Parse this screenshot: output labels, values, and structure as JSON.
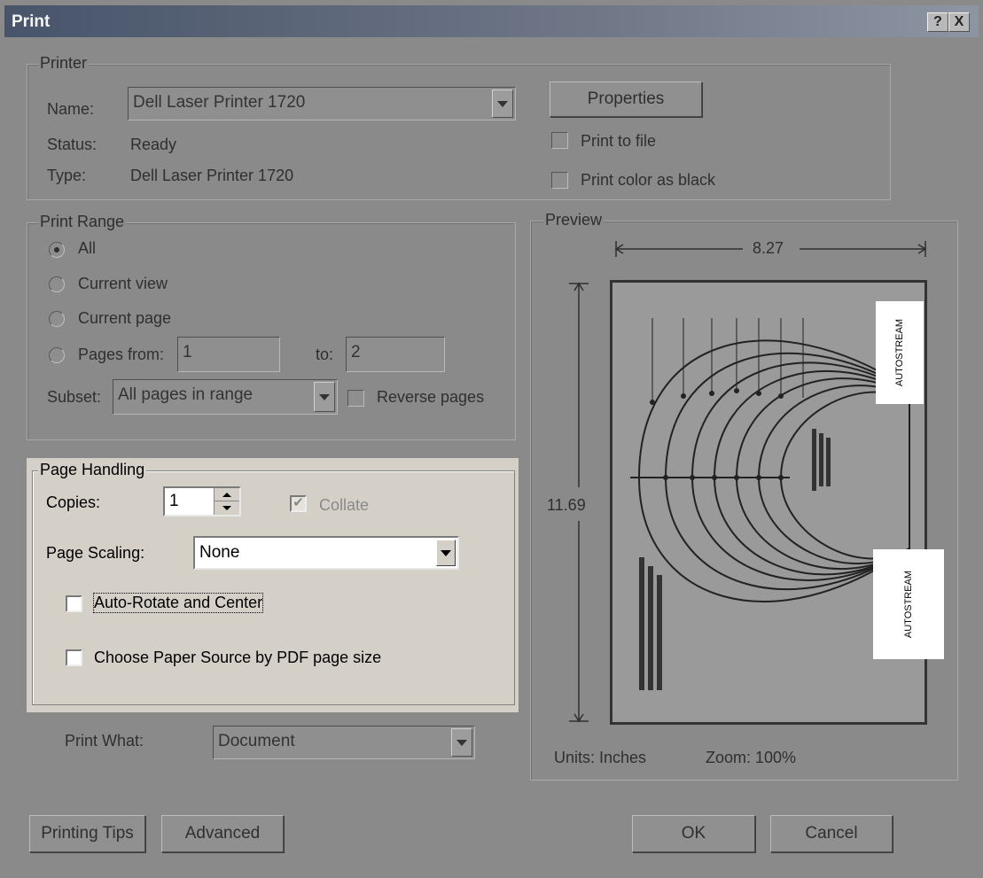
{
  "dialog": {
    "title": "Print",
    "help_glyph": "?",
    "close_glyph": "X"
  },
  "printer": {
    "legend": "Printer",
    "name_label": "Name:",
    "name_value": "Dell Laser Printer 1720",
    "status_label": "Status:",
    "status_value": "Ready",
    "type_label": "Type:",
    "type_value": "Dell Laser Printer 1720",
    "properties_label": "Properties",
    "print_to_file_label": "Print to file",
    "print_color_as_black_label": "Print color as black"
  },
  "print_range": {
    "legend": "Print Range",
    "all_label": "All",
    "current_view_label": "Current view",
    "current_page_label": "Current page",
    "pages_from_label": "Pages from:",
    "from_value": "1",
    "to_label": "to:",
    "to_value": "2",
    "subset_label": "Subset:",
    "subset_value": "All pages in range",
    "reverse_pages_label": "Reverse pages"
  },
  "page_handling": {
    "legend": "Page Handling",
    "copies_label": "Copies:",
    "copies_value": "1",
    "collate_label": "Collate",
    "page_scaling_label": "Page Scaling:",
    "page_scaling_value": "None",
    "auto_rotate_label": "Auto-Rotate and Center",
    "choose_paper_label": "Choose Paper Source by PDF page size"
  },
  "print_what": {
    "label": "Print What:",
    "value": "Document"
  },
  "preview": {
    "legend": "Preview",
    "width_value": "8.27",
    "height_value": "11.69",
    "units_text": "Units: Inches",
    "zoom_text": "Zoom: 100%",
    "autostream_top": "AUTOSTREAM",
    "autostream_bottom": "AUTOSTREAM"
  },
  "footer": {
    "printing_tips_label": "Printing Tips",
    "advanced_label": "Advanced",
    "ok_label": "OK",
    "cancel_label": "Cancel"
  }
}
